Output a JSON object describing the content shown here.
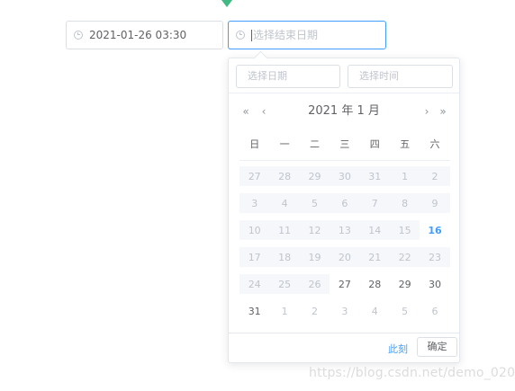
{
  "start_input": {
    "value": "2021-01-26 03:30",
    "icon": "clock-icon"
  },
  "end_input": {
    "placeholder": "选择结束日期",
    "icon": "clock-icon"
  },
  "panel": {
    "date_placeholder": "选择日期",
    "time_placeholder": "选择时间",
    "nav": {
      "prev_year": "«",
      "prev_month": "‹",
      "next_month": "›",
      "next_year": "»"
    },
    "title": "2021 年 1 月",
    "weekdays": [
      "日",
      "一",
      "二",
      "三",
      "四",
      "五",
      "六"
    ],
    "weeks": [
      [
        {
          "d": "27",
          "s": "past"
        },
        {
          "d": "28",
          "s": "past"
        },
        {
          "d": "29",
          "s": "past"
        },
        {
          "d": "30",
          "s": "past"
        },
        {
          "d": "31",
          "s": "past"
        },
        {
          "d": "1",
          "s": "past"
        },
        {
          "d": "2",
          "s": "past"
        }
      ],
      [
        {
          "d": "3",
          "s": "past"
        },
        {
          "d": "4",
          "s": "past"
        },
        {
          "d": "5",
          "s": "past"
        },
        {
          "d": "6",
          "s": "past"
        },
        {
          "d": "7",
          "s": "past"
        },
        {
          "d": "8",
          "s": "past"
        },
        {
          "d": "9",
          "s": "past"
        }
      ],
      [
        {
          "d": "10",
          "s": "past"
        },
        {
          "d": "11",
          "s": "past"
        },
        {
          "d": "12",
          "s": "past"
        },
        {
          "d": "13",
          "s": "past"
        },
        {
          "d": "14",
          "s": "past"
        },
        {
          "d": "15",
          "s": "past"
        },
        {
          "d": "16",
          "s": "today"
        }
      ],
      [
        {
          "d": "17",
          "s": "past"
        },
        {
          "d": "18",
          "s": "past"
        },
        {
          "d": "19",
          "s": "past"
        },
        {
          "d": "20",
          "s": "past"
        },
        {
          "d": "21",
          "s": "past"
        },
        {
          "d": "22",
          "s": "past"
        },
        {
          "d": "23",
          "s": "past"
        }
      ],
      [
        {
          "d": "24",
          "s": "past"
        },
        {
          "d": "25",
          "s": "past"
        },
        {
          "d": "26",
          "s": "past"
        },
        {
          "d": "27",
          "s": "normal"
        },
        {
          "d": "28",
          "s": "normal"
        },
        {
          "d": "29",
          "s": "normal"
        },
        {
          "d": "30",
          "s": "normal"
        }
      ],
      [
        {
          "d": "31",
          "s": "normal"
        },
        {
          "d": "1",
          "s": "next"
        },
        {
          "d": "2",
          "s": "next"
        },
        {
          "d": "3",
          "s": "next"
        },
        {
          "d": "4",
          "s": "next"
        },
        {
          "d": "5",
          "s": "next"
        },
        {
          "d": "6",
          "s": "next"
        }
      ]
    ],
    "footer": {
      "now_label": "此刻",
      "ok_label": "确定"
    }
  },
  "watermark": "https://blog.csdn.net/demo_020",
  "colors": {
    "accent": "#409eff",
    "marker": "#42b983",
    "disabled_bg": "#f5f7fa"
  }
}
